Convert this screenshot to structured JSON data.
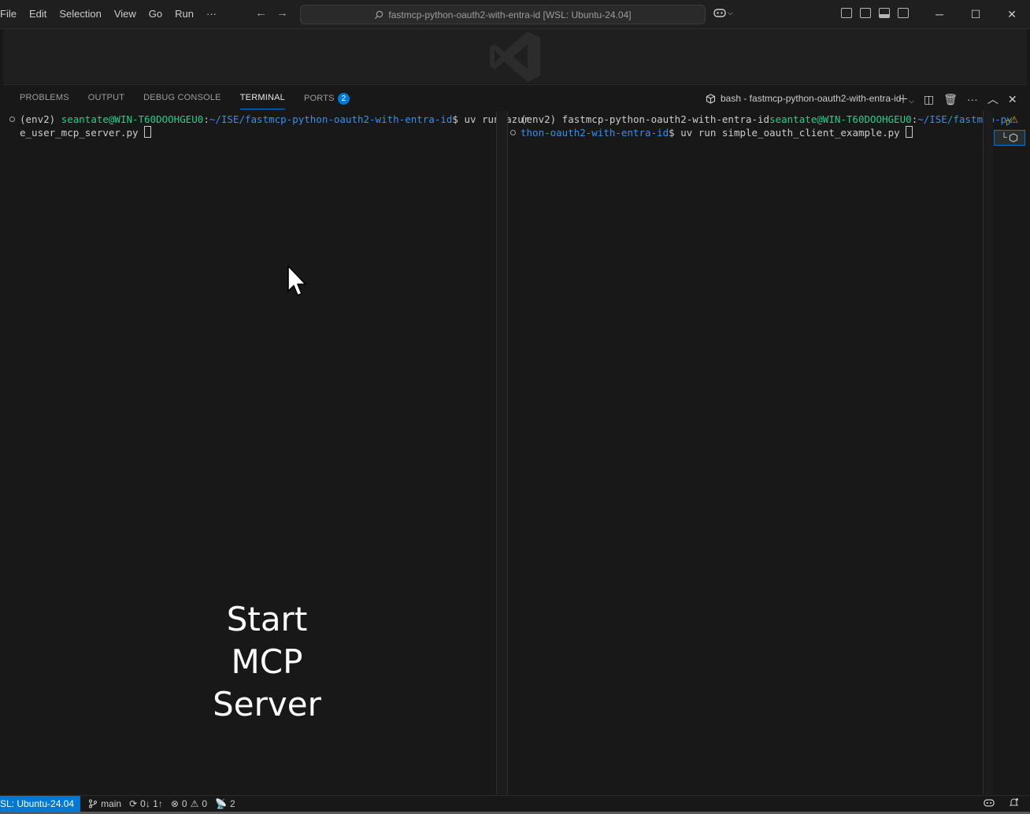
{
  "menu": [
    "File",
    "Edit",
    "Selection",
    "View",
    "Go",
    "Run",
    "···"
  ],
  "command_center": "fastmcp-python-oauth2-with-entra-id [WSL: Ubuntu-24.04]",
  "panel": {
    "tabs": [
      "PROBLEMS",
      "OUTPUT",
      "DEBUG CONSOLE",
      "TERMINAL",
      "PORTS"
    ],
    "active_tab": "TERMINAL",
    "ports_count": "2",
    "terminal_title": "bash - fastmcp-python-oauth2-with-entra-id"
  },
  "terminal_left": {
    "env": "(env2) ",
    "user_host": "seantate@WIN-T60DOOHGEU0",
    "colon": ":",
    "path": "~/ISE/fastmcp-python-oauth2-with-entra-id",
    "command_line1": "$ uv run azur",
    "command_line2": "e_user_mcp_server.py "
  },
  "terminal_right": {
    "env": "(env2) fastmcp-python-oauth2-with-entra-id",
    "user_host": "seantate@WIN-T60DOOHGEU0",
    "colon": ":",
    "path_line1": "~/ISE/fastmcp-py",
    "path_line2": "thon-oauth2-with-entra-id",
    "command": "$ uv run simple_oauth_client_example.py "
  },
  "overlay": {
    "line1": "Start",
    "line2": "MCP",
    "line3": "Server"
  },
  "statusbar": {
    "remote": "SL: Ubuntu-24.04",
    "branch": "main",
    "sync": "0↓ 1↑",
    "errors": "0",
    "warnings": "0",
    "ports": "2"
  },
  "colors": {
    "accent": "#0078d4",
    "green": "#23d18b",
    "blue": "#3b8eea"
  }
}
